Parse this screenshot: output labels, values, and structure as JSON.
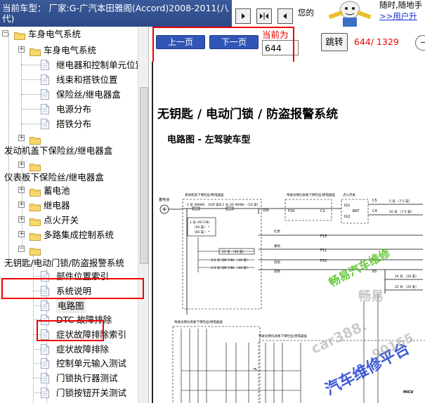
{
  "header": {
    "vehicle_label": "当前车型：",
    "vehicle_value": "厂家:G-广汽本田雅阁(Accord)2008-2011(八代)",
    "message": "您的",
    "slogan_line1": "随时,随地手",
    "slogan_link": ">>用户升"
  },
  "tree": {
    "items": [
      {
        "label": "车身电气系统",
        "kind": "folder",
        "expander": "-"
      },
      {
        "label": "车身电气系统",
        "kind": "folder",
        "expander": "+"
      },
      {
        "label": "继电器和控制单元位置",
        "kind": "doc"
      },
      {
        "label": "线束和搭铁位置",
        "kind": "doc"
      },
      {
        "label": "保险丝/继电器盒",
        "kind": "doc"
      },
      {
        "label": "电源分布",
        "kind": "doc"
      },
      {
        "label": "搭铁分布",
        "kind": "doc"
      },
      {
        "label": "",
        "kind": "folder",
        "expander": "+"
      },
      {
        "label": "发动机盖下保险丝/继电器盒",
        "kind": "text"
      },
      {
        "label": "",
        "kind": "folder",
        "expander": "+"
      },
      {
        "label": "仪表板下保险丝/继电器盒",
        "kind": "text"
      },
      {
        "label": "蓄电池",
        "kind": "folder",
        "expander": "+"
      },
      {
        "label": "继电器",
        "kind": "folder",
        "expander": "+"
      },
      {
        "label": "点火开关",
        "kind": "folder",
        "expander": "+"
      },
      {
        "label": "多路集成控制系统",
        "kind": "folder",
        "expander": "+"
      },
      {
        "label": "",
        "kind": "folder",
        "expander": "-"
      },
      {
        "label": "无钥匙/电动门锁/防盗报警系统",
        "kind": "text"
      },
      {
        "label": "部件位置索引",
        "kind": "doc"
      },
      {
        "label": "系统说明",
        "kind": "doc"
      },
      {
        "label": "电路图",
        "kind": "doc",
        "selected": true
      },
      {
        "label": "DTC 故障排除",
        "kind": "doc"
      },
      {
        "label": "症状故障排除索引",
        "kind": "doc"
      },
      {
        "label": "症状故障排除",
        "kind": "doc"
      },
      {
        "label": "控制单元输入测试",
        "kind": "doc"
      },
      {
        "label": "门锁执行器测试",
        "kind": "doc"
      },
      {
        "label": "门锁按钮开关测试",
        "kind": "doc"
      }
    ]
  },
  "toolbar": {
    "prev_label": "上一页",
    "next_label": "下一页",
    "current_label": "当前为",
    "page_value": "644",
    "go_label": "跳转",
    "page_count": "644/ 1329",
    "zoom_icon": "minus-icon"
  },
  "document": {
    "title": "无钥匙 / 电动门锁 / 防盗报警系统",
    "subtitle": "电路图 - 左驾驶车型",
    "labels": {
      "box1_title": "发动机盖下保险丝/继电器盒",
      "box2_title": "驾驶员侧仪表板下保险丝/继电器盒",
      "battery": "蓄电池",
      "main1": "1 号 (MAIN) （100 安）",
      "main2": "3-1 号 (IG MAIN) （50 安）",
      "absfb": "1 号 (AS F/B)",
      "absfb2": "（40 安） *",
      "absfb3": "（60 安） *",
      "fuse15": "15 号 （10 安）",
      "fuse32": "3-2 号 (DR F/B) （40 安）",
      "fuse33": "3-3 号 (DR F/B) （40 安）",
      "ignsw": "点火开关",
      "ig1": "IG1",
      "bat": "BAT",
      "ig2": "IG2",
      "white": "白色",
      "red": "红色",
      "yellow": "黄色",
      "f16": "F16",
      "c1": "C1",
      "c5": "C5",
      "c4": "C4",
      "f15": "F15",
      "f11": "F11",
      "f10": "F10",
      "b5": "B5",
      "fuse5": "5 号 （7.5 安）",
      "fuse16": "16 号 （7.5 安）",
      "fuse24": "24 号 （20 安）",
      "fuse25": "25 号 （20 安）",
      "lower_title": "驾驶员侧仪表板下保险丝/继电器盒",
      "lower_title2": "驾驶员侧仪表板下保险丝/继电器盒",
      "micu": "MICU",
      "star5": "*5"
    }
  },
  "watermarks": {
    "wm1": "畅易汽车维修",
    "wm2": "畅易",
    "wm3": "car388.",
    "wm4": "汽车维修平台",
    "wm5": "90165"
  },
  "colors": {
    "header_bg": "#2d4a86",
    "button_blue": "#3156b5",
    "highlight_red": "#e00000",
    "watermark_green": "#52c11f",
    "watermark_blue": "#1e3fd0"
  }
}
